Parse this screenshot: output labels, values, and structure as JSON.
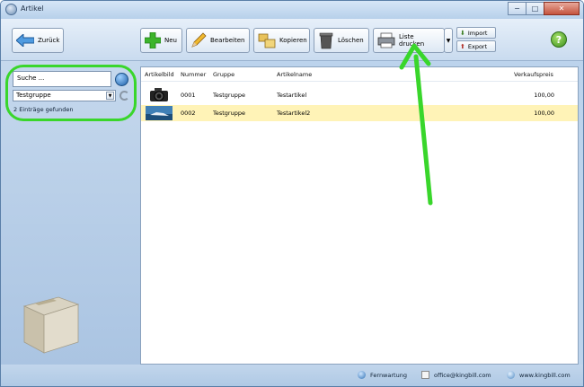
{
  "window": {
    "title": "Artikel",
    "minimize": "−",
    "maximize": "□",
    "close": "✕"
  },
  "toolbar": {
    "back_label": "Zurück",
    "new_label": "Neu",
    "edit_label": "Bearbeiten",
    "copy_label": "Kopieren",
    "delete_label": "Löschen",
    "print_list_label": "Liste drucken",
    "import_label": "Import",
    "export_label": "Export",
    "help_label": "?"
  },
  "sidebar": {
    "search_value": "Suche ...",
    "group_value": "Testgruppe",
    "found_text": "2 Einträge gefunden"
  },
  "table": {
    "headers": {
      "image": "Artikelbild",
      "number": "Nummer",
      "group": "Gruppe",
      "name": "Artikelname",
      "price": "Verkaufspreis"
    },
    "rows": [
      {
        "number": "0001",
        "group": "Testgruppe",
        "name": "Testartikel",
        "price": "100,00",
        "image_icon": "camera-icon"
      },
      {
        "number": "0002",
        "group": "Testgruppe",
        "name": "Testartikel2",
        "price": "100,00",
        "image_icon": "landscape-photo-icon"
      }
    ]
  },
  "statusbar": {
    "remote_label": "Fernwartung",
    "email_label": "office@kingbill.com",
    "web_label": "www.kingbill.com"
  },
  "colors": {
    "highlight_green": "#39d62b",
    "selected_row": "#fff3b7",
    "panel_blue": "#bcd3ec"
  }
}
